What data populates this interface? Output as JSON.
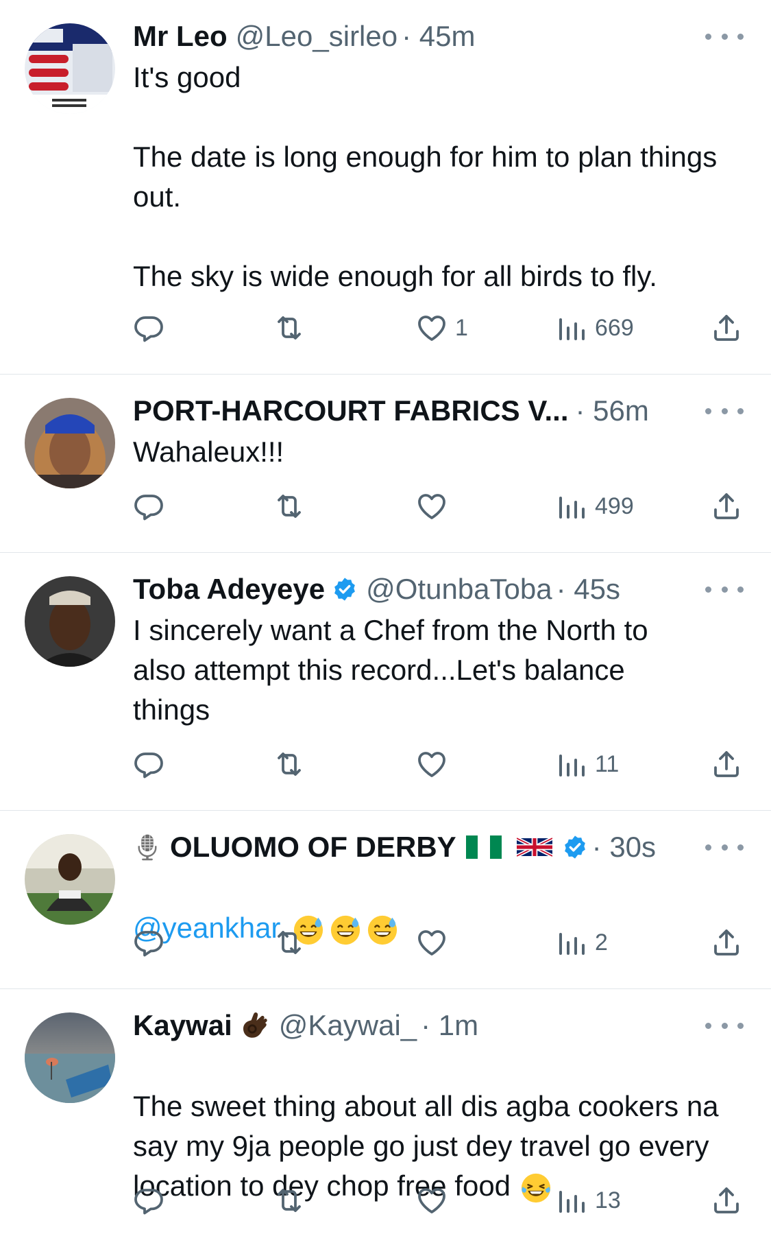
{
  "colors": {
    "text": "#0f1419",
    "secondary": "#536471",
    "link": "#1d9bf0",
    "verified": "#1d9bf0",
    "divider": "#e1e6ea"
  },
  "icons": {
    "reply": "speech-bubble",
    "retweet": "retweet-arrows",
    "like": "heart",
    "views": "bar-chart",
    "share": "upload-arrow",
    "more": "three-dots",
    "verified": "verified-badge"
  },
  "tweets": [
    {
      "name": "Mr Leo",
      "handle": "@Leo_sirleo",
      "time": "· 45m",
      "text": "It's good\n\nThe date is long enough for him to plan things out.\n\nThe sky is wide enough for all birds to fly.",
      "likes": "1",
      "views": "669"
    },
    {
      "name": "PORT-HARCOURT FABRICS V...",
      "time": "· 56m",
      "text": "Wahaleux!!!",
      "views": "499"
    },
    {
      "name": "Toba Adeyeye",
      "handle": "@OtunbaToba",
      "time": "· 45s",
      "text": "I sincerely want a Chef from the North to also attempt this record...Let's balance things",
      "views": "11"
    },
    {
      "name": "OLUOMO OF DERBY",
      "time": "· 30s",
      "mention": "@yeankhar",
      "views": "2"
    },
    {
      "name": "Kaywai",
      "handle": "@Kaywai_",
      "time": "· 1m",
      "text": "The sweet thing about all dis agba cookers na say my 9ja people go just dey travel go every location to dey chop free food",
      "views": "13"
    }
  ]
}
